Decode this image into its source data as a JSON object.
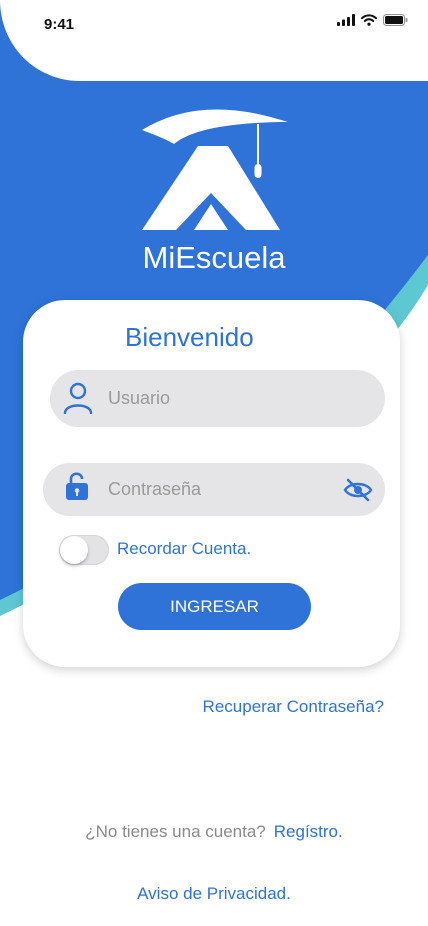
{
  "status_bar": {
    "time": "9:41",
    "icons": [
      "cellular-signal-icon",
      "wifi-icon",
      "battery-icon"
    ]
  },
  "app": {
    "name": "MiEscuela",
    "logo_icon": "graduation-cap-logo-icon"
  },
  "login_card": {
    "title": "Bienvenido",
    "username_placeholder": "Usuario",
    "username_value": "",
    "password_placeholder": "Contraseña",
    "password_value": "",
    "remember_label": "Recordar Cuenta.",
    "remember_enabled": false,
    "login_button": "INGRESAR"
  },
  "links": {
    "recover_password": "Recuperar Contraseña?",
    "no_account": "¿No tienes una cuenta?",
    "register": "Regístro.",
    "privacy": "Aviso de Privacidad."
  },
  "colors": {
    "primary_blue": "#2f73d9",
    "accent_teal": "#5ec8d2",
    "field_gray": "#e5e4e6",
    "background": "#ffffff"
  }
}
